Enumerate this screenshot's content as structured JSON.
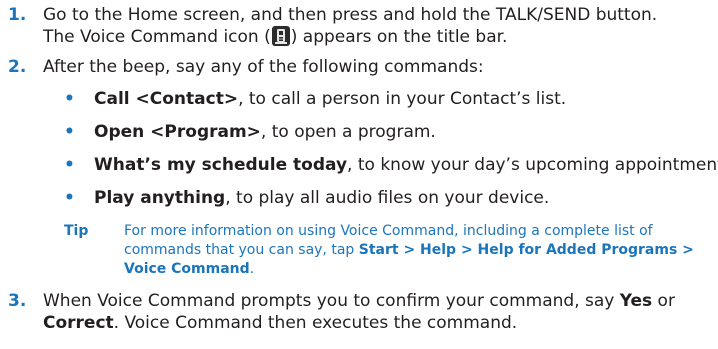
{
  "steps": [
    {
      "number": "1.",
      "line1": "Go to the Home screen, and then press and hold the TALK/SEND button.",
      "line2_before": "The Voice Command icon (",
      "line2_icon": "voice-command-icon",
      "line2_after": ") appears on the title bar."
    },
    {
      "number": "2.",
      "line1": "After the beep, say any of the following commands:"
    },
    {
      "number": "3.",
      "line1_before": "When Voice Command prompts you to confirm your command, say ",
      "line1_bold": "Yes",
      "line1_after": " or",
      "line2_bold": "Correct",
      "line2_after": ". Voice Command then executes the command."
    }
  ],
  "bullets": [
    {
      "marker": "•",
      "bold": "Call <Contact>",
      "rest": ", to call a person in your Contact’s list."
    },
    {
      "marker": "•",
      "bold": "Open <Program>",
      "rest": ", to open a program."
    },
    {
      "marker": "•",
      "bold": "What’s my schedule today",
      "rest": ", to know your day’s upcoming appointments."
    },
    {
      "marker": "•",
      "bold": "Play anything",
      "rest": ", to play all audio files on your device."
    }
  ],
  "tip": {
    "label": "Tip",
    "line1": "For more information on using Voice Command, including a complete list of",
    "line2_before": "commands that you can say, tap ",
    "line2_bold": "Start > Help > Help for Added Programs >",
    "line3_bold": "Voice Command",
    "line3_after": "."
  },
  "colors": {
    "accent": "#1b75bb",
    "text": "#231f20"
  }
}
